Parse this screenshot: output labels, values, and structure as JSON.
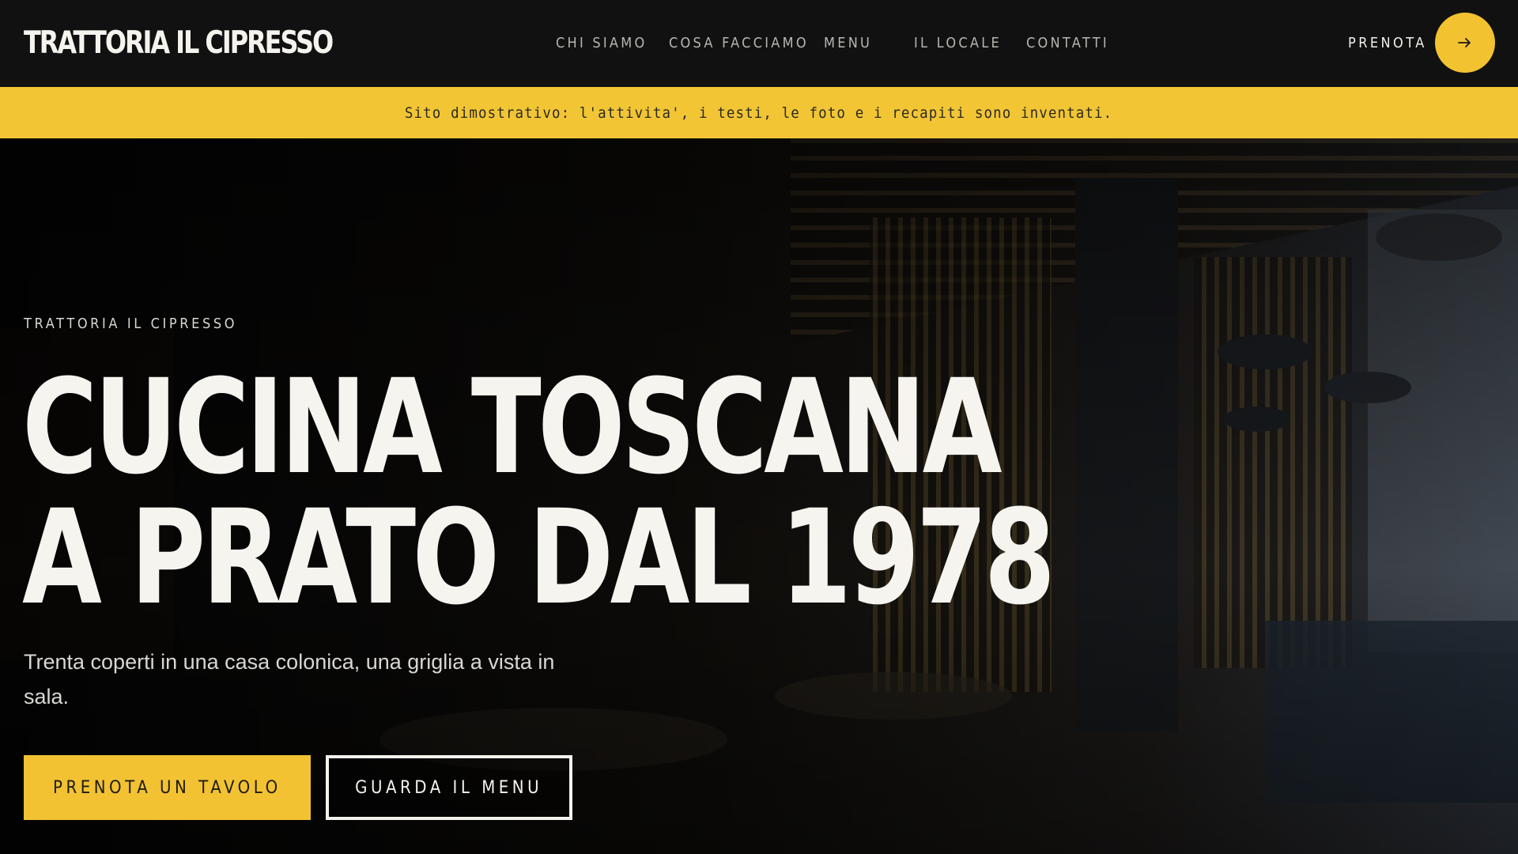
{
  "header": {
    "brand": "TRATTORIA IL CIPRESSO",
    "nav": [
      "CHI SIAMO",
      "COSA FACCIAMO",
      "MENU",
      "IL LOCALE",
      "CONTATTI"
    ],
    "cta_label": "PRENOTA"
  },
  "notice": {
    "text": "Sito dimostrativo: l'attivita', i testi, le foto e i recapiti sono inventati."
  },
  "hero": {
    "eyebrow": "TRATTORIA IL CIPRESSO",
    "headline_line1": "CUCINA TOSCANA",
    "headline_line2": "A PRATO DAL 1978",
    "subtitle": "Trenta coperti in una casa colonica, una griglia a vista in sala.",
    "primary_button": "PRENOTA UN TAVOLO",
    "secondary_button": "GUARDA IL MENU"
  },
  "colors": {
    "accent": "#f2c233",
    "header_bg": "#111111",
    "text_light": "#f6f4ef"
  },
  "icons": {
    "book_arrow": "arrow-right-icon"
  }
}
